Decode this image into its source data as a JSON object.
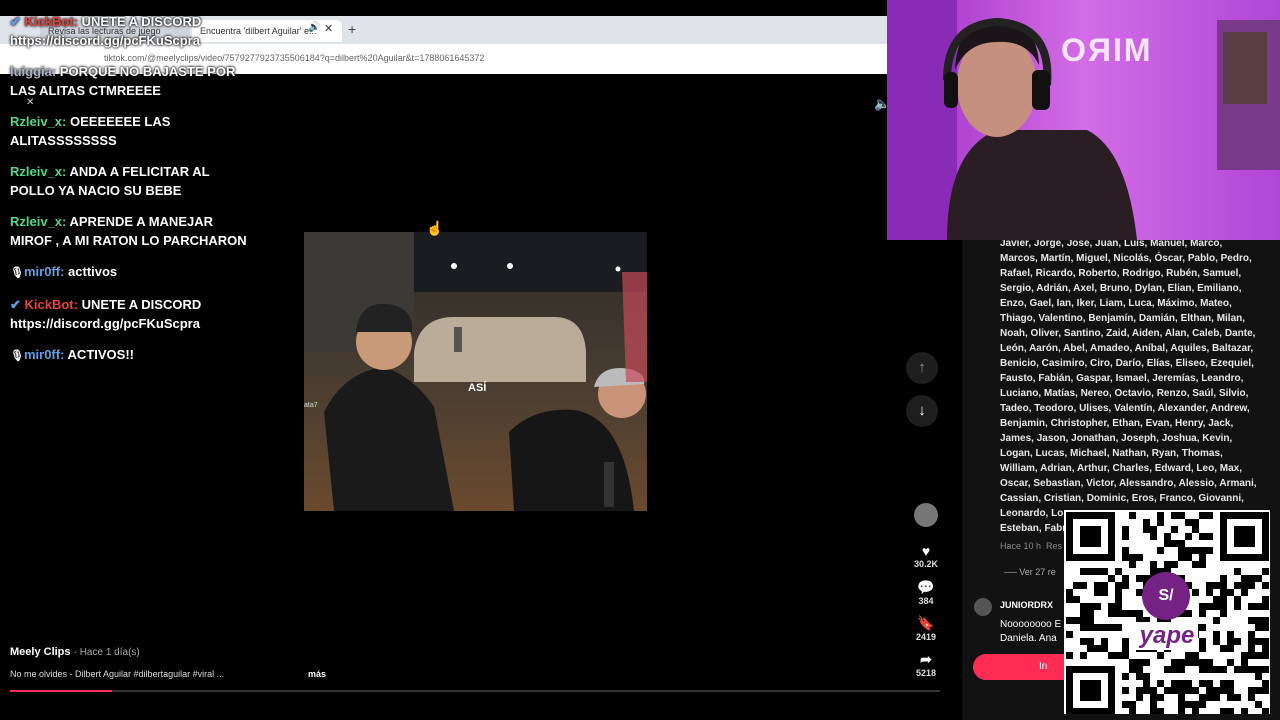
{
  "browser": {
    "tabs": [
      {
        "label": "Revisa las lecturas de juego"
      },
      {
        "label": "Encuentra 'dilbert Aguilar' e..."
      }
    ],
    "url": "tiktok.com/@meelyclips/video/7579277923735506184?q=dilbert%20Aguilar&t=1788061645372"
  },
  "chat": [
    {
      "user": "KickBot:",
      "user_color": "red",
      "text": "UNETE A DISCORD https://discord.gg/pcFKuScpra",
      "badge": true
    },
    {
      "user": "luiggia:",
      "user_color": "gray",
      "text": "PORQUE NO BAJASTE POR LAS ALITAS CTMREEEE"
    },
    {
      "user": "Rzleiv_x:",
      "user_color": "green",
      "text": "OEEEEEEE LAS ALITASSSSSSSS"
    },
    {
      "user": "Rzleiv_x:",
      "user_color": "green",
      "text": "ANDA A FELICITAR AL POLLO YA NACIO SU BEBE"
    },
    {
      "user": "Rzleiv_x:",
      "user_color": "green",
      "text": "APRENDE A MANEJAR MIROF , A MI RATON LO PARCHARON"
    },
    {
      "user": "mir0ff:",
      "user_color": "blue",
      "text": "acttivos",
      "mic": true
    },
    {
      "user": "KickBot:",
      "user_color": "red",
      "text": "UNETE A DISCORD https://discord.gg/pcFKuScpra",
      "badge": true
    },
    {
      "user": "mir0ff:",
      "user_color": "blue",
      "text": "ACTIVOS!!",
      "mic": true
    }
  ],
  "video": {
    "caption": "ASÍ",
    "watermark": "ata7"
  },
  "post": {
    "author": "Meely Clips",
    "time": "· Hace 1 día(s)",
    "description": "No me olvides - Dilbert Aguilar #dilbertaguilar #viral ...",
    "more": "más"
  },
  "actions": {
    "likes": "30.2K",
    "comments": "384",
    "saves": "2419",
    "shares": "5218"
  },
  "comments": {
    "names_text": "Javier, Jorge, José, Juan, Luis, Manuel, Marco, Marcos, Martín, Miguel, Nicolás, Óscar, Pablo, Pedro, Rafael, Ricardo, Roberto, Rodrigo, Rubén, Samuel, Sergio, Adrián, Axel, Bruno, Dylan, Elian, Emiliano, Enzo, Gael, Ian, Iker, Liam, Luca, Máximo, Mateo, Thiago, Valentino, Benjamín, Damián, Elthan, Milan, Noah, Oliver, Santino, Zaid, Aiden, Alan, Caleb, Dante, León, Aarón, Abel, Amadeo, Aníbal, Aquiles, Baltazar, Benicio, Casimiro, Ciro, Darío, Elías, Eliseo, Ezequiel, Fausto, Fabián, Gaspar, Ismael, Jeremías, Leandro, Luciano, Matías, Nereo, Octavio, Renzo, Saúl, Silvio, Tadeo, Teodoro, Ulises, Valentín, Alexander, Andrew, Benjamin, Christopher, Ethan, Evan, Henry, Jack, James, Jason, Jonathan, Joseph, Joshua, Kevin, Logan, Lucas, Michael, Nathan, Ryan, Thomas, William, Adrian, Arthur, Charles, Edward, Leo, Max, Oscar, Sebastian, Victor, Alessandro, Alessio, Armani, Cassian, Cristian, Dominic, Eros, Franco, Giovanni, Leonardo, Lor",
    "names_tail": "Esteban, Fabr",
    "time": "Hace 10 h",
    "reply": "Res",
    "view_more": "Ver 27 re",
    "user2": "JUNIORDRX",
    "text2": "Noooooooo E",
    "text2b": "Daniela, Ana",
    "input_label": "In"
  },
  "qr": {
    "brand": "yape",
    "badge": "S/"
  },
  "webcam": {
    "wall_text": "MIRO"
  },
  "progress": 0.11
}
